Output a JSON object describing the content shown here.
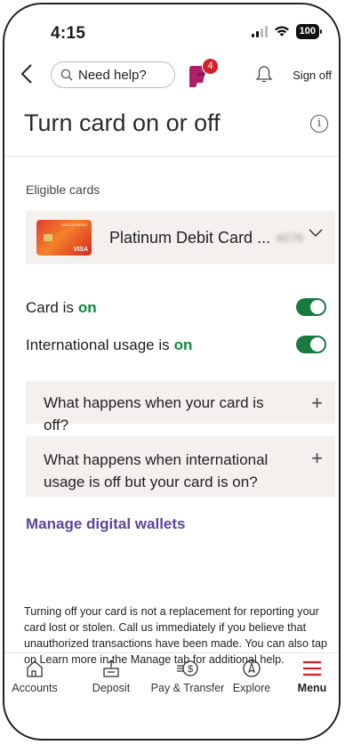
{
  "status": {
    "time": "4:15",
    "battery": "100"
  },
  "nav": {
    "search_placeholder": "Need help?",
    "fargo_badge": "4",
    "sign_off": "Sign off"
  },
  "page": {
    "title": "Turn card on or off"
  },
  "eligible": {
    "heading": "Eligible cards",
    "card_name": "Platinum Debit Card ...",
    "card_last4_masked": "4076"
  },
  "toggles": [
    {
      "label": "Card is",
      "state": "on"
    },
    {
      "label": "International usage is",
      "state": "on"
    }
  ],
  "accordions": [
    {
      "label": "What happens when your card is off?"
    },
    {
      "label": "What happens when international usage is off but your card is on?"
    }
  ],
  "manage_link": "Manage digital wallets",
  "disclaimer": "Turning off your card is not a replacement for reporting your card lost or stolen. Call us immediately if you believe that unauthorized transactions have been made. You can also tap on Learn more in the Manage tab for additional help.",
  "tabs": [
    {
      "label": "Accounts",
      "icon": "home-icon"
    },
    {
      "label": "Deposit",
      "icon": "deposit-icon"
    },
    {
      "label": "Pay & Transfer",
      "icon": "pay-transfer-icon"
    },
    {
      "label": "Explore",
      "icon": "compass-icon"
    },
    {
      "label": "Menu",
      "icon": "menu-icon"
    }
  ],
  "colors": {
    "accent_green": "#177a3f",
    "on_text": "#0a8a3e",
    "link_purple": "#5a469b",
    "menu_red": "#d71e28",
    "panel_bg": "#f4f0ed"
  }
}
